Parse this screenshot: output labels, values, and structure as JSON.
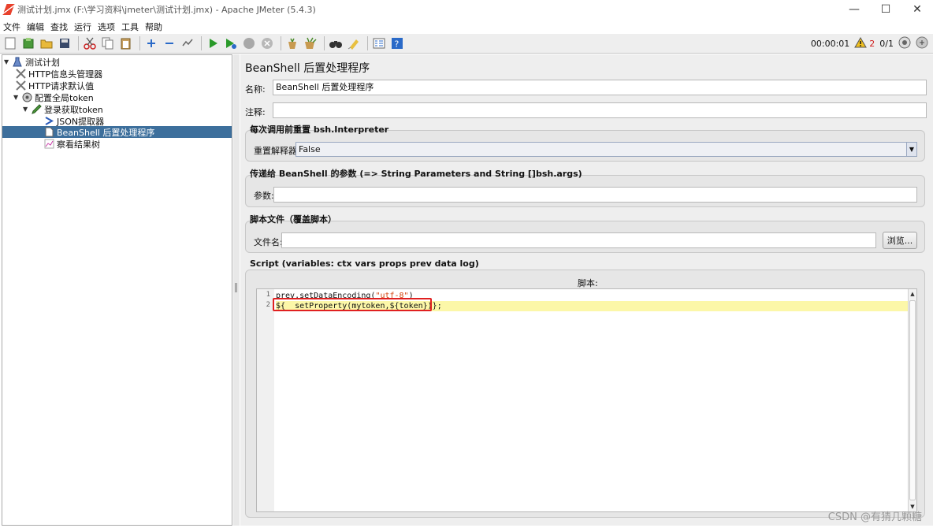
{
  "window": {
    "title": "测试计划.jmx (F:\\学习资料\\jmeter\\测试计划.jmx) - Apache JMeter (5.4.3)",
    "minimize": "—",
    "maximize": "☐",
    "close": "✕"
  },
  "menu": [
    "文件",
    "编辑",
    "查找",
    "运行",
    "选项",
    "工具",
    "帮助"
  ],
  "toolbar": {
    "timer": "00:00:01",
    "warnings": "2",
    "threads": "0/1"
  },
  "tree": [
    {
      "label": "测试计划",
      "icon": "flask-icon"
    },
    {
      "label": "HTTP信息头管理器",
      "icon": "wrench-icon"
    },
    {
      "label": "HTTP请求默认值",
      "icon": "wrench-icon"
    },
    {
      "label": "配置全局token",
      "icon": "gear-icon"
    },
    {
      "label": "登录获取token",
      "icon": "pencil-icon"
    },
    {
      "label": "JSON提取器",
      "icon": "arrow-icon"
    },
    {
      "label": "BeanShell 后置处理程序",
      "icon": "doc-icon"
    },
    {
      "label": "察看结果树",
      "icon": "chart-icon"
    }
  ],
  "panel": {
    "title": "BeanShell 后置处理程序",
    "name_label": "名称:",
    "name_value": "BeanShell 后置处理程序",
    "comment_label": "注释:",
    "comment_value": "",
    "reset_group_title": "每次调用前重置 bsh.Interpreter",
    "reset_label": "重置解释器:",
    "reset_value": "False",
    "params_group_title": "传递给 BeanShell 的参数 (=> String Parameters and String []bsh.args)",
    "params_label": "参数:",
    "params_value": "",
    "file_group_title": "脚本文件（覆盖脚本）",
    "file_label": "文件名:",
    "file_value": "",
    "browse_label": "浏览...",
    "script_group_title": "Script (variables: ctx vars props prev data log)",
    "script_label": "脚本:",
    "script_lines": [
      {
        "num": "1",
        "code": "prev.setDataEncoding(\"utf-8\")"
      },
      {
        "num": "2",
        "code": "${__setProperty(mytoken,${token})};"
      }
    ]
  },
  "watermark": "CSDN @有猜几颗糖"
}
